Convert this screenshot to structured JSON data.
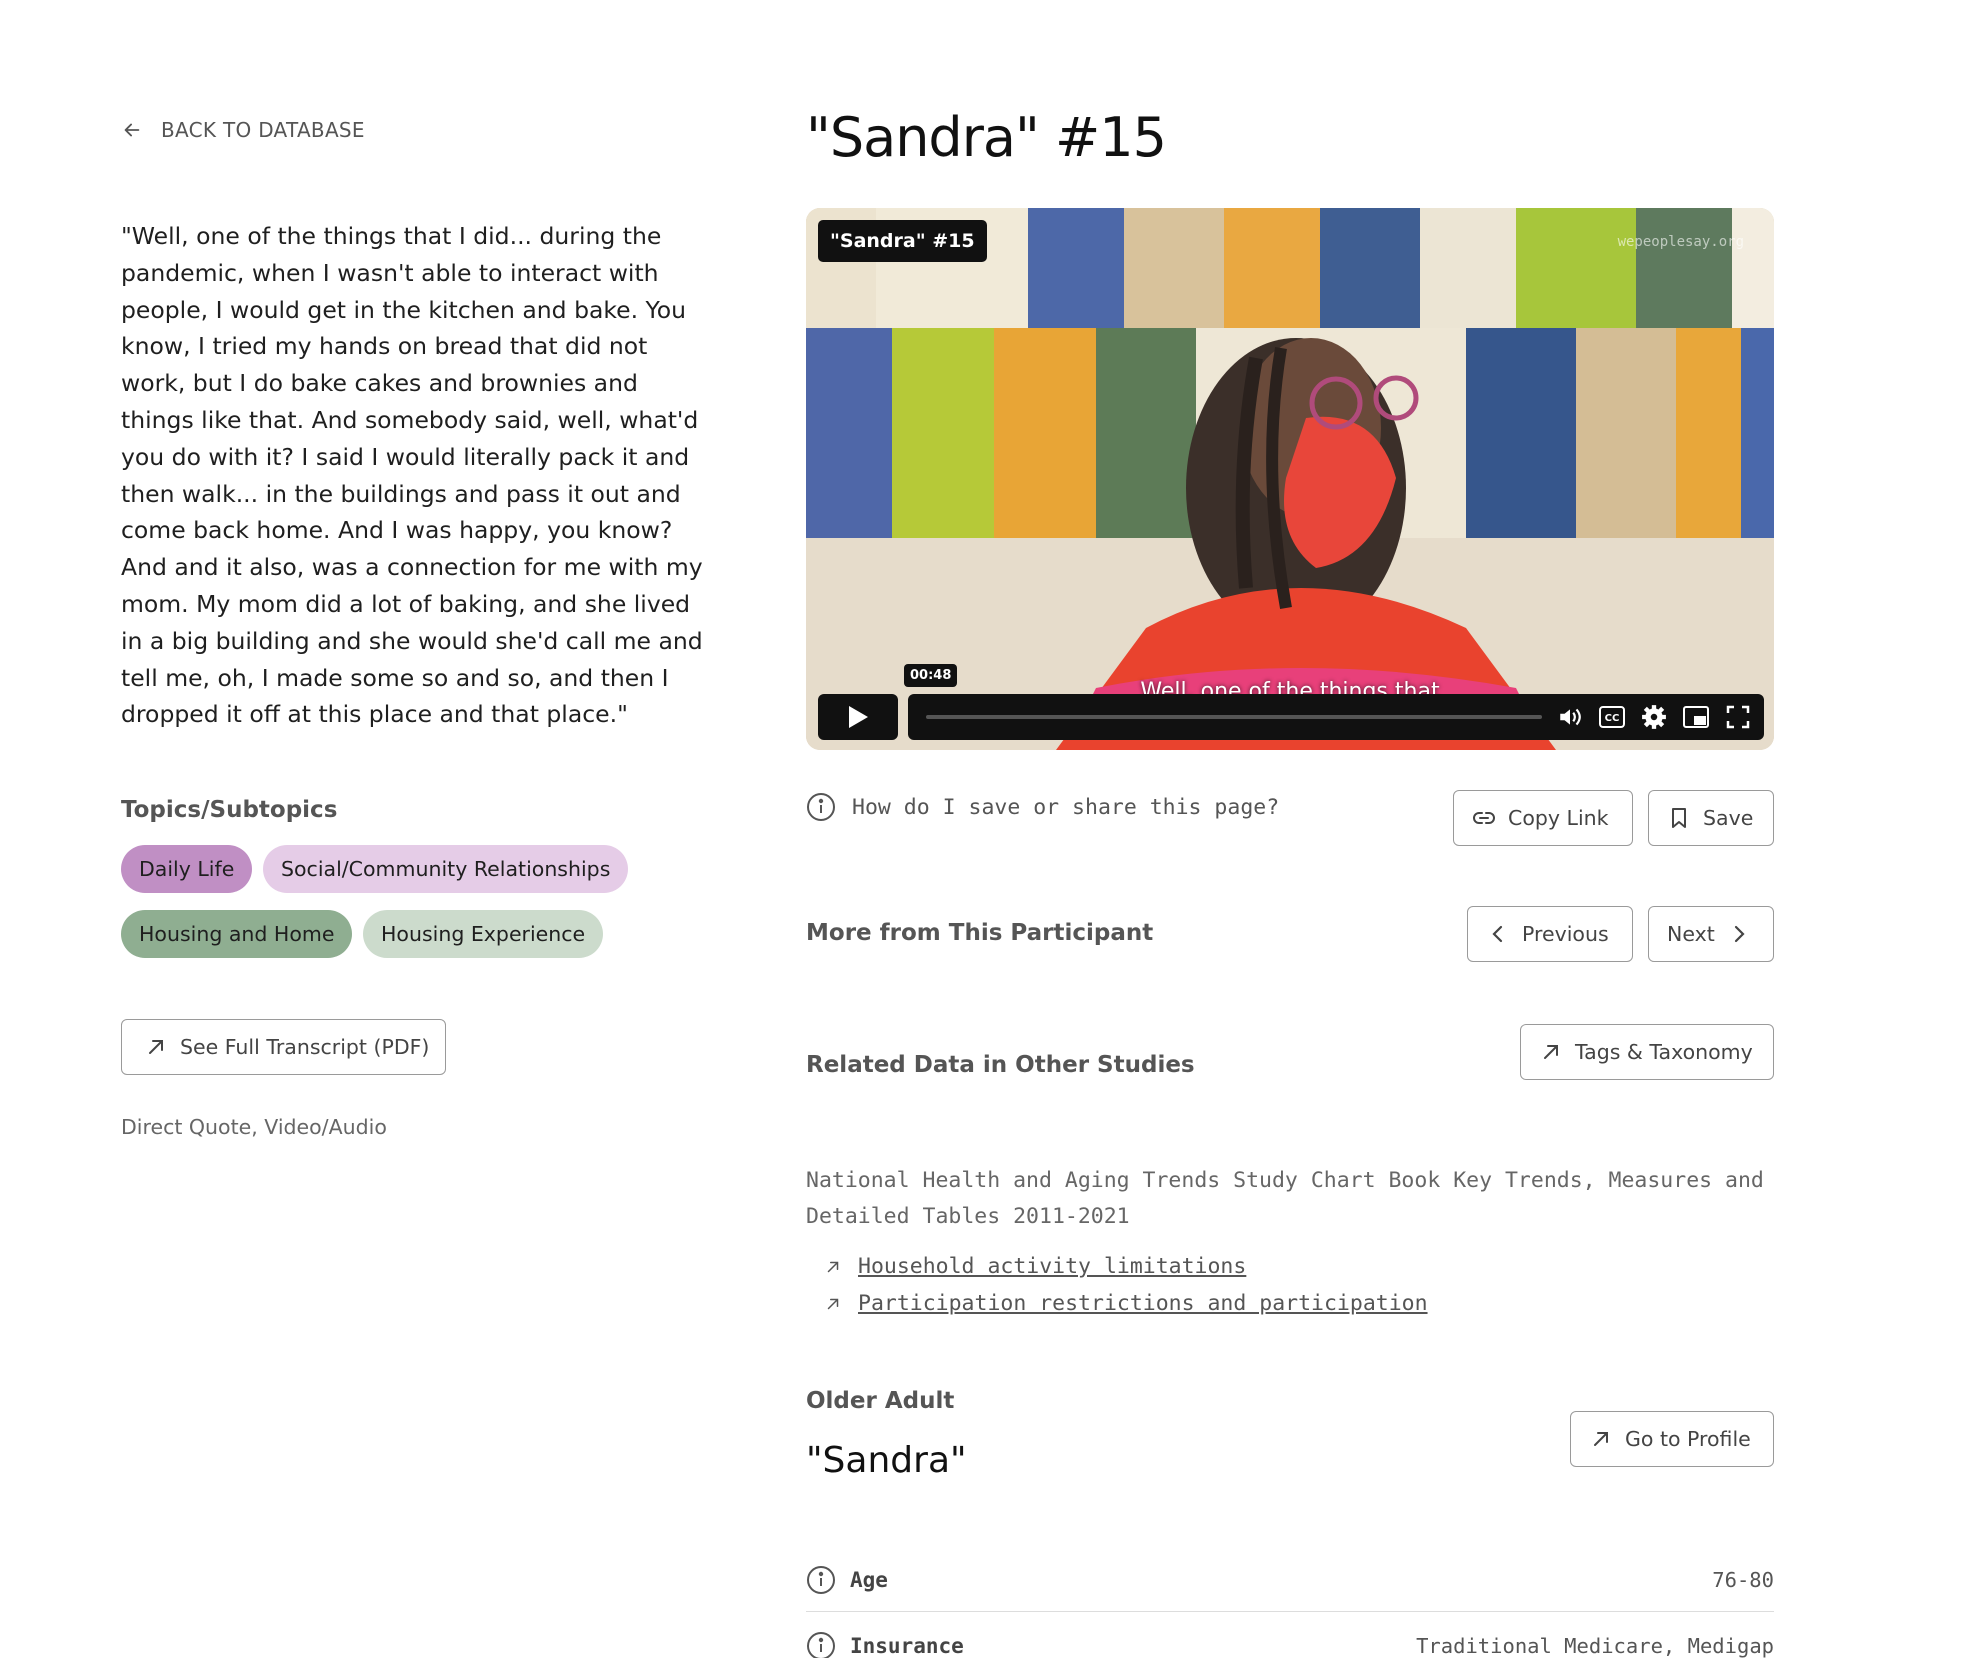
{
  "nav": {
    "back_label": "BACK TO DATABASE"
  },
  "quote": "\"Well, one of the things that I did... during the pandemic, when I wasn't able to interact with people, I would get in the kitchen and bake. You know, I tried my hands on bread that did not work, but I do bake cakes and brownies and things like that. And somebody said, well, what'd you do with it? I said I would literally pack it and then walk... in the buildings and pass it out and come back home. And I was happy, you know? And and it also, was a connection for me with my mom. My mom did a lot of baking, and she lived in a big building and she would she'd call me and tell me, oh, I made some so and so, and then I dropped it off at this place and that place.\"",
  "topics": {
    "heading": "Topics/Subtopics",
    "chips": [
      {
        "label": "Daily Life",
        "color": "#c08fc4"
      },
      {
        "label": "Social/Community Relationships",
        "color": "#e5cce7"
      },
      {
        "label": "Housing and Home",
        "color": "#8fae91"
      },
      {
        "label": "Housing Experience",
        "color": "#ccdbcc"
      }
    ]
  },
  "transcript_button": "See Full Transcript (PDF)",
  "media_type": "Direct Quote, Video/Audio",
  "title": "\"Sandra\" #15",
  "video": {
    "badge": "\"Sandra\" #15",
    "watermark": "wepeoplesay.org",
    "subtitle": "Well, one of the things that",
    "timestamp": "00:48",
    "icons": [
      "play-icon",
      "volume-icon",
      "captions-icon",
      "settings-icon",
      "pip-icon",
      "fullscreen-icon"
    ]
  },
  "share": {
    "question": "How do I save or share this page?",
    "copy_label": "Copy Link",
    "save_label": "Save"
  },
  "participant_nav": {
    "heading": "More from This Participant",
    "prev_label": "Previous",
    "next_label": "Next"
  },
  "related": {
    "heading": "Related Data in Other Studies",
    "tags_label": "Tags & Taxonomy",
    "study_title": "National Health and Aging Trends Study Chart Book Key Trends, Measures and Detailed Tables 2011-2021",
    "links": [
      "Household activity limitations",
      "Participation restrictions and participation"
    ]
  },
  "participant": {
    "role": "Older Adult",
    "name": "\"Sandra\"",
    "profile_label": "Go to Profile",
    "attributes": [
      {
        "label": "Age",
        "value": "76-80"
      },
      {
        "label": "Insurance",
        "value": "Traditional Medicare, Medigap"
      }
    ]
  }
}
